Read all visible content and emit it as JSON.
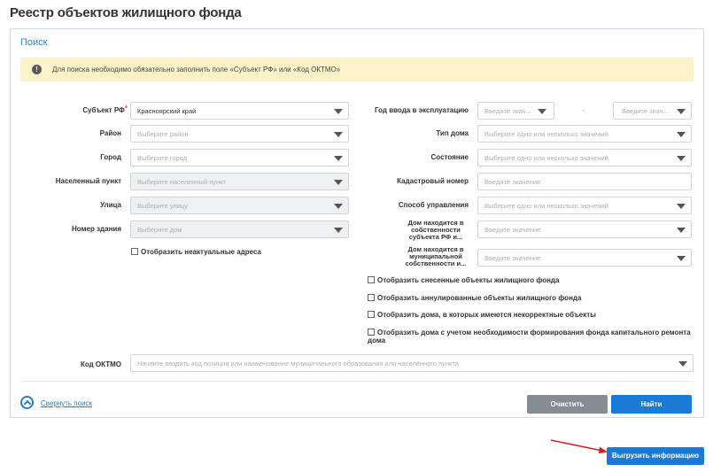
{
  "page": {
    "title": "Реестр объектов жилищного фонда"
  },
  "search": {
    "title": "Поиск",
    "alert": "Для поиска необходимо обязательно заполнить поле «Субъект РФ» или «Код ОКТМО»",
    "left": {
      "subject_label": "Субъект РФ",
      "subject_value": "Красноярский край",
      "district_label": "Район",
      "district_placeholder": "Выберите район",
      "city_label": "Город",
      "city_placeholder": "Выберите город",
      "locality_label": "Населенный пункт",
      "locality_placeholder": "Выберите населенный пункт",
      "street_label": "Улица",
      "street_placeholder": "Выберите улицу",
      "building_label": "Номер здания",
      "building_placeholder": "Выберите дом",
      "show_outdated_label": "Отобразить неактуальные адреса"
    },
    "right": {
      "year_label": "Год ввода в эксплуатацию",
      "year_from_placeholder": "Введите знач...",
      "year_to_placeholder": "Введите знач...",
      "year_dash": "-",
      "house_type_label": "Тип дома",
      "house_type_placeholder": "Выберите одно или несколько значений",
      "state_label": "Состояние",
      "state_placeholder": "Выберите одно или несколько значений",
      "cadastral_label": "Кадастровый номер",
      "cadastral_placeholder": "Введите значение",
      "management_label": "Способ управления",
      "management_placeholder": "Выберите одно или несколько значений",
      "subject_owned_label": "Дом находится в собственности субъекта РФ и...",
      "subject_owned_placeholder": "Введите значение",
      "municipal_owned_label": "Дом находится в муниципальной собственности и...",
      "municipal_owned_placeholder": "Введите значение"
    },
    "checkboxes": [
      "Отобразить снесенные объекты жилищного фонда",
      "Отобразить аннулированные объекты жилищного фонда",
      "Отобразить дома, в которых имеются некорректные объекты",
      "Отобразить дома с учетом необходимости формирования фонда капитального ремонта дома"
    ],
    "oktmo_label": "Код ОКТМО",
    "oktmo_placeholder": "Начните вводить код позиции или наименование муниципального образования или населённого пункта",
    "collapse_label": "Свернуть поиск",
    "clear_button": "Очистить",
    "find_button": "Найти"
  },
  "export_button": "Выгрузить информацию",
  "colors": {
    "accent": "#1a7ad6",
    "alert_bg": "#fbf2c7",
    "arrow": "#d62020"
  }
}
